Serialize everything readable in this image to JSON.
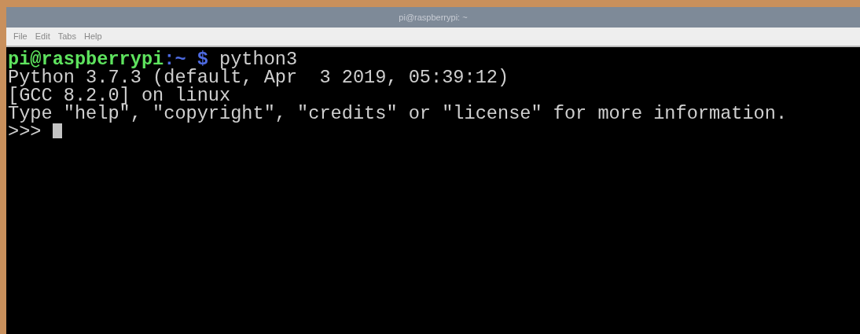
{
  "window": {
    "title": "pi@raspberrypi: ~"
  },
  "menu": [
    "File",
    "Edit",
    "Tabs",
    "Help"
  ],
  "terminal": {
    "lines": [
      {
        "segments": [
          {
            "kind": "user",
            "text": "pi@raspberrypi"
          },
          {
            "kind": "path",
            "text": ":~"
          },
          {
            "kind": "symbol",
            "text": " $"
          },
          {
            "kind": "plain",
            "text": " python3"
          }
        ]
      },
      {
        "segments": [
          {
            "kind": "plain",
            "text": "Python 3.7.3 (default, Apr  3 2019, 05:39:12)"
          }
        ]
      },
      {
        "segments": [
          {
            "kind": "plain",
            "text": "[GCC 8.2.0] on linux"
          }
        ]
      },
      {
        "segments": [
          {
            "kind": "plain",
            "text": "Type \"help\", \"copyright\", \"credits\" or \"license\" for more information."
          }
        ]
      },
      {
        "segments": [
          {
            "kind": "plain",
            "text": ">>> "
          }
        ],
        "cursor": true
      }
    ]
  }
}
